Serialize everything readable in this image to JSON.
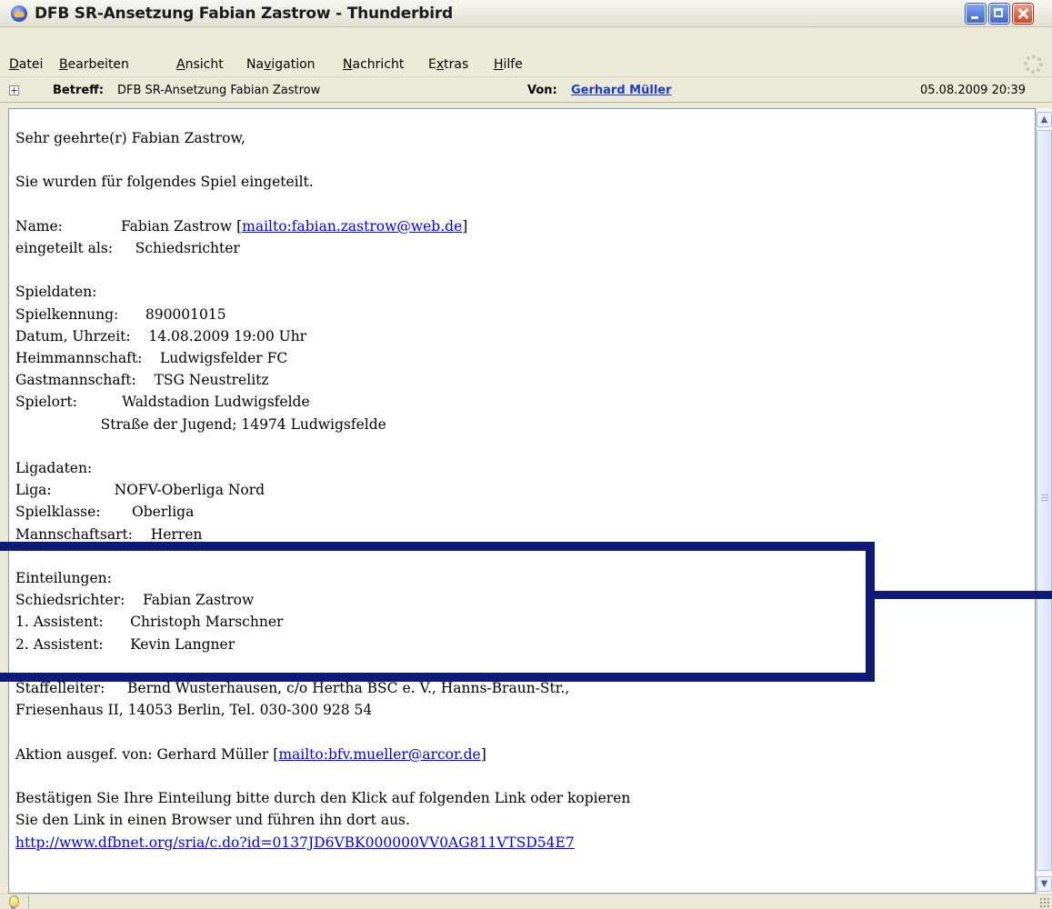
{
  "window": {
    "title": "DFB SR-Ansetzung Fabian Zastrow - Thunderbird"
  },
  "menu": {
    "items": [
      {
        "label": "Datei",
        "access": "D",
        "rest": "atei"
      },
      {
        "label": "Bearbeiten",
        "access": "B",
        "rest": "earbeiten"
      },
      {
        "label": "Ansicht",
        "access": "A",
        "rest": "nsicht"
      },
      {
        "label": "Navigation",
        "pre": "Na",
        "access": "v",
        "rest": "igation"
      },
      {
        "label": "Nachricht",
        "access": "N",
        "rest": "achricht"
      },
      {
        "label": "Extras",
        "pre": "E",
        "access": "x",
        "rest": "tras"
      },
      {
        "label": "Hilfe",
        "access": "H",
        "rest": "ilfe"
      }
    ]
  },
  "header": {
    "subject_label": "Betreff:",
    "subject_value": "DFB SR-Ansetzung Fabian Zastrow",
    "from_label": "Von:",
    "from_value": "Gerhard Müller",
    "date": "05.08.2009 20:39"
  },
  "message": {
    "greeting": "Sehr geehrte(r) Fabian Zastrow,",
    "intro": "Sie wurden für folgendes Spiel eingeteilt.",
    "name_label": "Name:",
    "name_value": "Fabian Zastrow [",
    "name_mailto": "mailto:fabian.zastrow@web.de",
    "assigned_label": "eingeteilt als:",
    "assigned_value": "Schiedsrichter",
    "spieldaten_heading": "Spieldaten:",
    "spielkennung_label": "Spielkennung:",
    "spielkennung_value": "890001015",
    "datum_label": "Datum, Uhrzeit:",
    "datum_value": "14.08.2009 19:00 Uhr",
    "heim_label": "Heimmannschaft:",
    "heim_value": "Ludwigsfelder FC",
    "gast_label": "Gastmannschaft:",
    "gast_value": "TSG Neustrelitz",
    "spielort_label": "Spielort:",
    "spielort_value": "Waldstadion Ludwigsfelde",
    "spielort_address": "Straße der Jugend; 14974 Ludwigsfelde",
    "ligadaten_heading": "Ligadaten:",
    "liga_label": "Liga:",
    "liga_value": "NOFV-Oberliga Nord",
    "spielklasse_label": "Spielklasse:",
    "spielklasse_value": "Oberliga",
    "mannschaftsart_label": "Mannschaftsart:",
    "mannschaftsart_value": "Herren",
    "einteilungen_heading": "Einteilungen:",
    "sr_label": "Schiedsrichter:",
    "sr_value": "Fabian Zastrow",
    "a1_label": "1. Assistent:",
    "a1_value": "Christoph Marschner",
    "a2_label": "2. Assistent:",
    "a2_value": "Kevin Langner",
    "staffel_label": "Staffelleiter:",
    "staffel_value": "Bernd Wusterhausen, c/o Hertha BSC e. V., Hanns-Braun-Str.,",
    "staffel_value2": "Friesenhaus II, 14053 Berlin, Tel. 030-300 928 54",
    "aktion_text": "Aktion ausgef. von: Gerhard Müller [",
    "aktion_mailto": "mailto:bfv.mueller@arcor.de",
    "confirm_line1": "Bestätigen Sie Ihre Einteilung bitte durch den Klick auf folgenden Link oder kopieren",
    "confirm_line2": "Sie den Link in einen Browser und führen ihn dort aus.",
    "confirm_link": "http://www.dfbnet.org/sria/c.do?id=0137JD6VBK000000VV0AG811VTSD54E7",
    "bracket_close": "]"
  },
  "colors": {
    "link": "#0000ee",
    "highlight": "#0d1a78"
  }
}
